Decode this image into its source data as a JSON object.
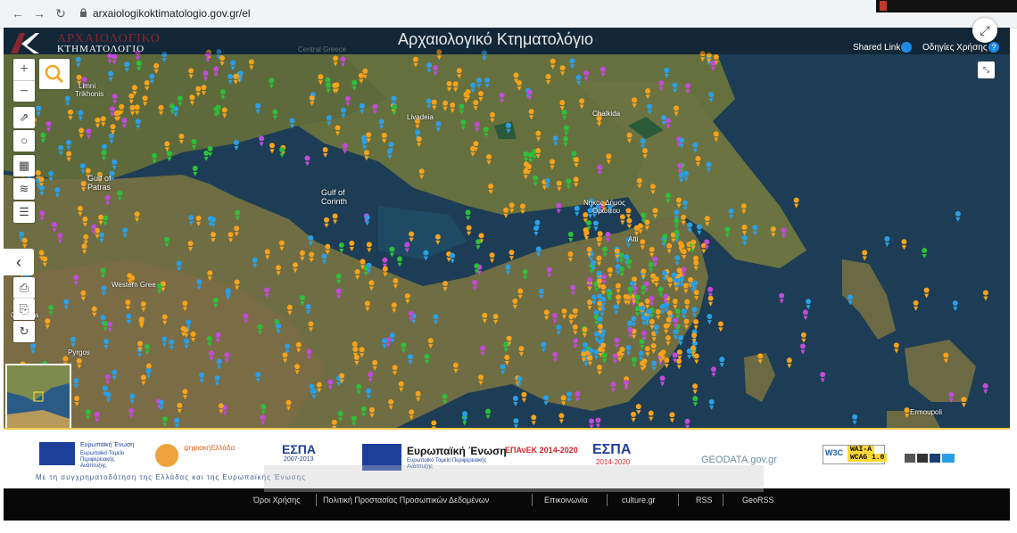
{
  "browser": {
    "url": "arxaiologikoktimatologio.gov.gr/el",
    "nav_icons": [
      "back-arrow-icon",
      "forward-arrow-icon",
      "reload-icon"
    ]
  },
  "header": {
    "logo_line1": "ΑΡΧΑΙΟΛΟΓΙΚΟ",
    "logo_line2": "ΚΤΗΜΑΤΟΛΟΓΙΟ",
    "title": "Αρχαιολογικό Κτηματολόγιο",
    "shared_link": "Shared Link",
    "guide": "Οδηγίες Χρήσης"
  },
  "map": {
    "labels": [
      "Limni Trichonis",
      "Gulf of Patras",
      "Gulf of Corinth",
      "Western Gree",
      "Chalkida",
      "Pyrgos",
      "Livadeia",
      "Chalkida",
      "Νηκος Δήμος Ορωπου",
      "Atti",
      "Ermoupoli",
      "Central Greece"
    ],
    "colors": {
      "orange": "#f7a21b",
      "blue": "#2b9fe6",
      "purple": "#c14bd8",
      "green": "#2dbf3a"
    }
  },
  "tools": {
    "zoom_in": "+",
    "zoom_out": "−",
    "collapse": "‹"
  },
  "footer": {
    "eu_text": "Ευρωπαϊκή Ένωση",
    "eu_sub": "Ευρωπαϊκό Ταμείο Περιφερειακής Ανάπτυξης",
    "digital_greece": "ψηφιακήΕλλάδα",
    "espa1": "ΕΣΠΑ",
    "espa1_years": "2007-2013",
    "eu_text2": "Ευρωπαϊκή Ένωση",
    "eu_sub2": "Ευρωπαϊκό Ταμείο Περιφερειακής Ανάπτυξης",
    "epanek": "ΕΠΑνΕΚ 2014-2020",
    "espa2": "ΕΣΠΑ",
    "espa2_years": "2014-2020",
    "geodata": "GEODATA.gov.gr",
    "wcag_w3c": "W3C",
    "wcag_level": "WAI-A",
    "wcag_version": "WCAG 1.0",
    "cofinance": "Με τη συγχρηματοδότηση της Ελλάδας και της Ευρωπαϊκής Ένωσης",
    "links": [
      "Όροι Χρήσης",
      "Πολιτική Προστασίας Προσωπικών Δεδομένων",
      "Επικοινωνία",
      "culture.gr",
      "RSS",
      "GeoRSS"
    ]
  }
}
